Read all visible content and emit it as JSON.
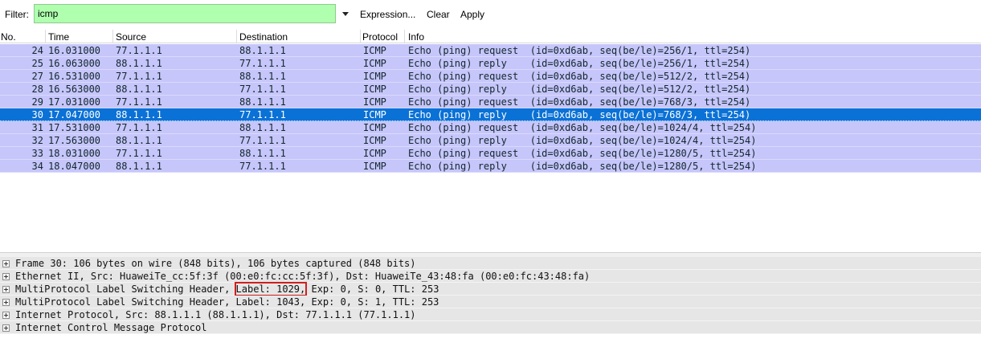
{
  "filter": {
    "label": "Filter:",
    "value": "icmp",
    "expression_label": "Expression...",
    "clear_label": "Clear",
    "apply_label": "Apply"
  },
  "packet_list": {
    "columns": [
      "No.",
      "Time",
      "Source",
      "Destination",
      "Protocol",
      "Info"
    ],
    "selected_no": "30",
    "rows": [
      {
        "no": "24",
        "time": "16.031000",
        "src": "77.1.1.1",
        "dst": "88.1.1.1",
        "proto": "ICMP",
        "info": "Echo (ping) request  (id=0xd6ab, seq(be/le)=256/1, ttl=254)"
      },
      {
        "no": "25",
        "time": "16.063000",
        "src": "88.1.1.1",
        "dst": "77.1.1.1",
        "proto": "ICMP",
        "info": "Echo (ping) reply    (id=0xd6ab, seq(be/le)=256/1, ttl=254)"
      },
      {
        "no": "27",
        "time": "16.531000",
        "src": "77.1.1.1",
        "dst": "88.1.1.1",
        "proto": "ICMP",
        "info": "Echo (ping) request  (id=0xd6ab, seq(be/le)=512/2, ttl=254)"
      },
      {
        "no": "28",
        "time": "16.563000",
        "src": "88.1.1.1",
        "dst": "77.1.1.1",
        "proto": "ICMP",
        "info": "Echo (ping) reply    (id=0xd6ab, seq(be/le)=512/2, ttl=254)"
      },
      {
        "no": "29",
        "time": "17.031000",
        "src": "77.1.1.1",
        "dst": "88.1.1.1",
        "proto": "ICMP",
        "info": "Echo (ping) request  (id=0xd6ab, seq(be/le)=768/3, ttl=254)"
      },
      {
        "no": "30",
        "time": "17.047000",
        "src": "88.1.1.1",
        "dst": "77.1.1.1",
        "proto": "ICMP",
        "info": "Echo (ping) reply    (id=0xd6ab, seq(be/le)=768/3, ttl=254)"
      },
      {
        "no": "31",
        "time": "17.531000",
        "src": "77.1.1.1",
        "dst": "88.1.1.1",
        "proto": "ICMP",
        "info": "Echo (ping) request  (id=0xd6ab, seq(be/le)=1024/4, ttl=254)"
      },
      {
        "no": "32",
        "time": "17.563000",
        "src": "88.1.1.1",
        "dst": "77.1.1.1",
        "proto": "ICMP",
        "info": "Echo (ping) reply    (id=0xd6ab, seq(be/le)=1024/4, ttl=254)"
      },
      {
        "no": "33",
        "time": "18.031000",
        "src": "77.1.1.1",
        "dst": "88.1.1.1",
        "proto": "ICMP",
        "info": "Echo (ping) request  (id=0xd6ab, seq(be/le)=1280/5, ttl=254)"
      },
      {
        "no": "34",
        "time": "18.047000",
        "src": "88.1.1.1",
        "dst": "77.1.1.1",
        "proto": "ICMP",
        "info": "Echo (ping) reply    (id=0xd6ab, seq(be/le)=1280/5, ttl=254)"
      }
    ]
  },
  "details": {
    "items": [
      {
        "text": "Frame 30: 106 bytes on wire (848 bits), 106 bytes captured (848 bits)"
      },
      {
        "text": "Ethernet II, Src: HuaweiTe_cc:5f:3f (00:e0:fc:cc:5f:3f), Dst: HuaweiTe_43:48:fa (00:e0:fc:43:48:fa)"
      },
      {
        "pre": "MultiProtocol Label Switching Header, ",
        "highlight": "Label: 1029,",
        "post": " Exp: 0, S: 0, TTL: 253"
      },
      {
        "text": "MultiProtocol Label Switching Header, Label: 1043, Exp: 0, S: 1, TTL: 253"
      },
      {
        "text": "Internet Protocol, Src: 88.1.1.1 (88.1.1.1), Dst: 77.1.1.1 (77.1.1.1)"
      },
      {
        "text": "Internet Control Message Protocol"
      }
    ]
  },
  "colors": {
    "row_bg": "#c6c6fa",
    "selected_bg": "#0a71d6",
    "filter_bg": "#afffaf",
    "highlight_box": "#d01f1f"
  }
}
